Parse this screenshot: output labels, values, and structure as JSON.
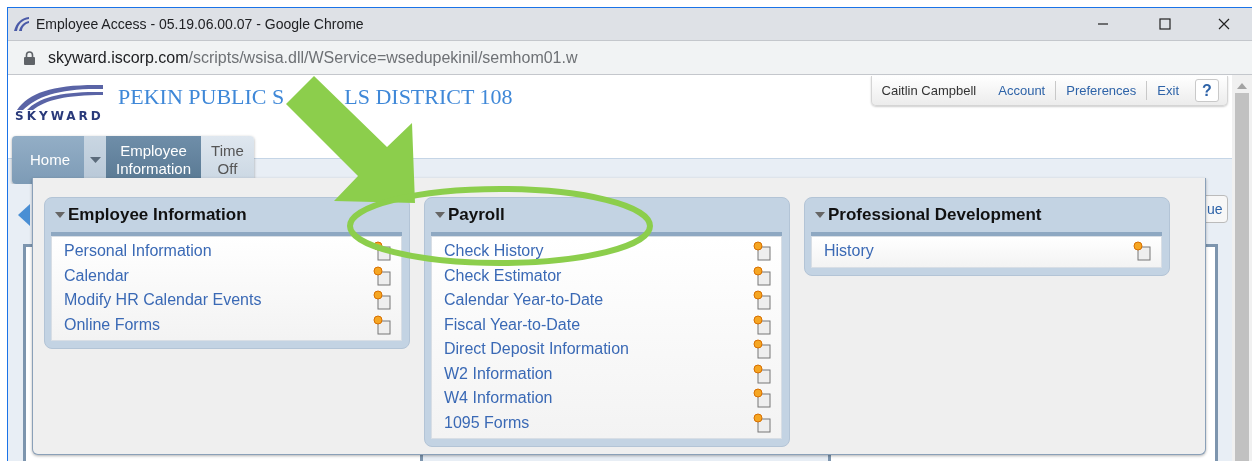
{
  "window": {
    "title": "Employee Access - 05.19.06.00.07 - Google Chrome"
  },
  "address_bar": {
    "host": "skyward.iscorp.com",
    "path": "/scripts/wsisa.dll/WService=wsedupekinil/semhom01.w"
  },
  "site": {
    "logo": "SKYWARD",
    "title_parts": [
      "PEKIN PUBLIC S",
      "LS DISTRICT 108"
    ]
  },
  "user_links": [
    {
      "label": "Caitlin Campbell",
      "kind": "name"
    },
    {
      "label": "Account",
      "kind": "link"
    },
    {
      "label": "Preferences",
      "kind": "link"
    },
    {
      "label": "Exit",
      "kind": "link"
    },
    {
      "label": "?",
      "kind": "help"
    }
  ],
  "nav_tabs": [
    {
      "label": "Home",
      "kind": "home",
      "selected": false
    },
    {
      "label": "Employee\nInformation",
      "kind": "tab",
      "selected": true
    },
    {
      "label": "Time\nOff",
      "kind": "tab",
      "selected": false
    }
  ],
  "background": {
    "button_fragment": "ue"
  },
  "panels": [
    {
      "title": "Employee Information",
      "items": [
        "Personal Information",
        "Calendar",
        "Modify HR Calendar Events",
        "Online Forms"
      ]
    },
    {
      "title": "Payroll",
      "items": [
        "Check History",
        "Check Estimator",
        "Calendar Year-to-Date",
        "Fiscal Year-to-Date",
        "Direct Deposit Information",
        "W2 Information",
        "W4 Information",
        "1095 Forms"
      ]
    },
    {
      "title": "Professional Development",
      "items": [
        "History"
      ]
    }
  ]
}
